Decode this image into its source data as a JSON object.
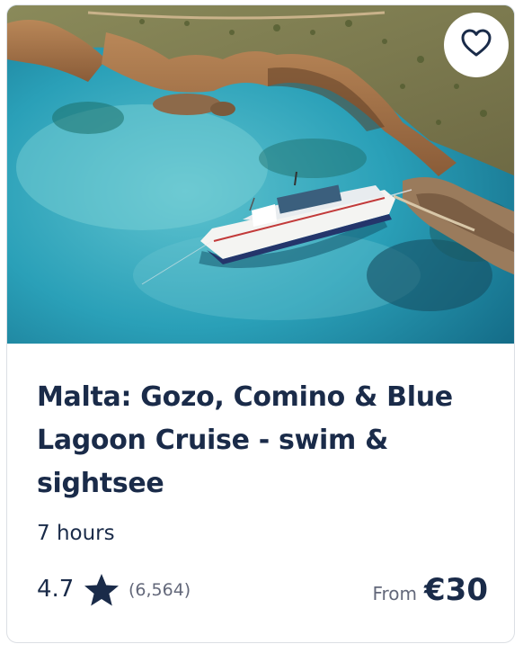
{
  "card": {
    "image_alt": "Aerial view of a cruise boat anchored in a turquoise lagoon beside rocky cliffs",
    "favorite_icon": "heart-outline-icon",
    "title": "Malta: Gozo, Comino & Blue Lagoon Cruise - swim & sightsee",
    "duration": "7 hours",
    "rating": "4.7",
    "rating_icon": "star-icon",
    "review_count": "(6,564)",
    "price_prefix": "From",
    "price": "€30"
  },
  "colors": {
    "text_primary": "#1a2b49",
    "text_secondary": "#63687a",
    "border": "#dcdfe4"
  }
}
